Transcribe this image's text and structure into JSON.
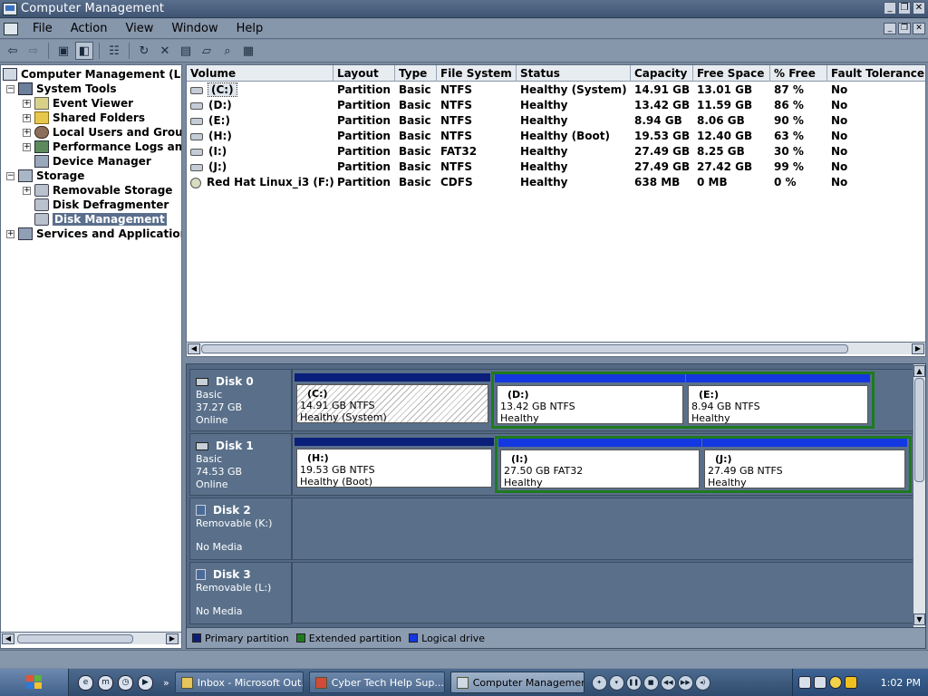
{
  "window": {
    "title": "Computer Management"
  },
  "menu": [
    "File",
    "Action",
    "View",
    "Window",
    "Help"
  ],
  "tree": {
    "root": "Computer Management (Lo",
    "items": [
      {
        "label": "System Tools"
      },
      {
        "label": "Event Viewer"
      },
      {
        "label": "Shared Folders"
      },
      {
        "label": "Local Users and Grou"
      },
      {
        "label": "Performance Logs an"
      },
      {
        "label": "Device Manager"
      },
      {
        "label": "Storage"
      },
      {
        "label": "Removable Storage"
      },
      {
        "label": "Disk Defragmenter"
      },
      {
        "label": "Disk Management"
      },
      {
        "label": "Services and Application"
      }
    ]
  },
  "volumes": {
    "columns": [
      "Volume",
      "Layout",
      "Type",
      "File System",
      "Status",
      "Capacity",
      "Free Space",
      "% Free",
      "Fault Tolerance"
    ],
    "rows": [
      [
        "(C:)",
        "Partition",
        "Basic",
        "NTFS",
        "Healthy (System)",
        "14.91 GB",
        "13.01 GB",
        "87 %",
        "No"
      ],
      [
        "(D:)",
        "Partition",
        "Basic",
        "NTFS",
        "Healthy",
        "13.42 GB",
        "11.59 GB",
        "86 %",
        "No"
      ],
      [
        "(E:)",
        "Partition",
        "Basic",
        "NTFS",
        "Healthy",
        "8.94 GB",
        "8.06 GB",
        "90 %",
        "No"
      ],
      [
        "(H:)",
        "Partition",
        "Basic",
        "NTFS",
        "Healthy (Boot)",
        "19.53 GB",
        "12.40 GB",
        "63 %",
        "No"
      ],
      [
        "(I:)",
        "Partition",
        "Basic",
        "FAT32",
        "Healthy",
        "27.49 GB",
        "8.25 GB",
        "30 %",
        "No"
      ],
      [
        "(J:)",
        "Partition",
        "Basic",
        "NTFS",
        "Healthy",
        "27.49 GB",
        "27.42 GB",
        "99 %",
        "No"
      ],
      [
        "Red Hat Linux_i3 (F:)",
        "Partition",
        "Basic",
        "CDFS",
        "Healthy",
        "638 MB",
        "0 MB",
        "0 %",
        "No"
      ]
    ]
  },
  "disks": [
    {
      "name": "Disk 0",
      "type": "Basic",
      "size": "37.27 GB",
      "state": "Online",
      "partitions": [
        {
          "name": "(C:)",
          "detail": "14.91 GB NTFS",
          "status": "Healthy (System)"
        },
        {
          "name": "(D:)",
          "detail": "13.42 GB NTFS",
          "status": "Healthy"
        },
        {
          "name": "(E:)",
          "detail": "8.94 GB NTFS",
          "status": "Healthy"
        }
      ]
    },
    {
      "name": "Disk 1",
      "type": "Basic",
      "size": "74.53 GB",
      "state": "Online",
      "partitions": [
        {
          "name": "(H:)",
          "detail": "19.53 GB NTFS",
          "status": "Healthy (Boot)"
        },
        {
          "name": "(I:)",
          "detail": "27.50 GB FAT32",
          "status": "Healthy"
        },
        {
          "name": "(J:)",
          "detail": "27.49 GB NTFS",
          "status": "Healthy"
        }
      ]
    },
    {
      "name": "Disk 2",
      "type": "Removable (K:)",
      "state": "No Media"
    },
    {
      "name": "Disk 3",
      "type": "Removable (L:)",
      "state": "No Media"
    }
  ],
  "legend": [
    {
      "label": "Primary partition",
      "color": "#0a1f7a"
    },
    {
      "label": "Extended partition",
      "color": "#1f7a1f"
    },
    {
      "label": "Logical drive",
      "color": "#1337e0"
    }
  ],
  "taskbar": {
    "tasks": [
      "Inbox - Microsoft Out...",
      "Cyber Tech Help Sup...",
      "Computer Management"
    ],
    "clock": "1:02 PM"
  }
}
